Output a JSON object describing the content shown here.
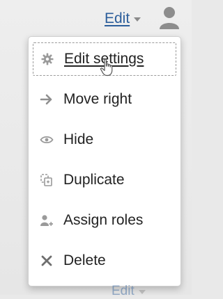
{
  "header": {
    "edit_label": "Edit",
    "user_icon": "user-icon"
  },
  "menu": {
    "items": [
      {
        "label": "Edit settings",
        "icon": "gear-icon",
        "focused": true
      },
      {
        "label": "Move right",
        "icon": "arrow-right-icon"
      },
      {
        "label": "Hide",
        "icon": "eye-icon"
      },
      {
        "label": "Duplicate",
        "icon": "duplicate-icon"
      },
      {
        "label": "Assign roles",
        "icon": "user-plus-icon"
      },
      {
        "label": "Delete",
        "icon": "close-icon"
      }
    ]
  },
  "footer": {
    "edit_label": "Edit"
  },
  "colors": {
    "link": "#2c5e9b",
    "icon": "#9a9a9a",
    "text": "#222222"
  }
}
